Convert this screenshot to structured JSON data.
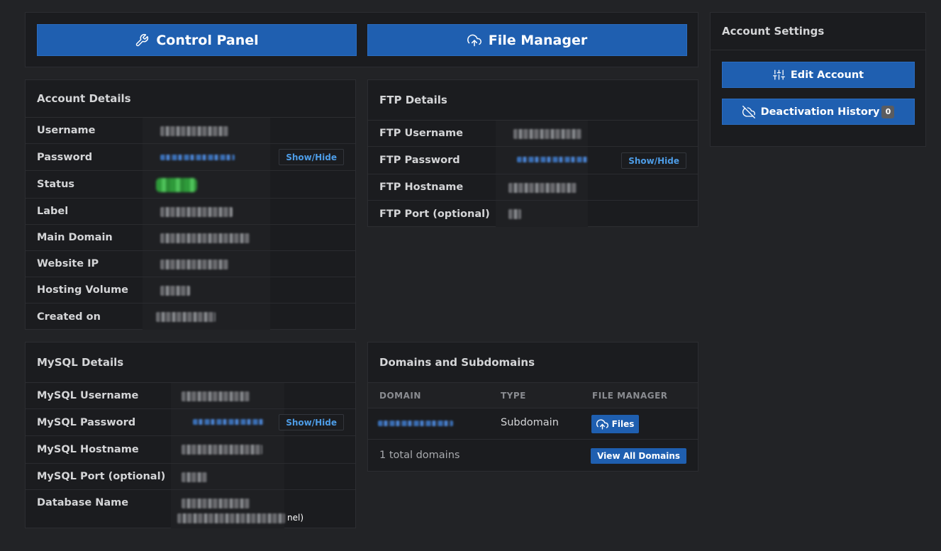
{
  "top_buttons": {
    "control_panel": "Control Panel",
    "file_manager": "File Manager"
  },
  "account_details": {
    "title": "Account Details",
    "rows": [
      {
        "label": "Username"
      },
      {
        "label": "Password"
      },
      {
        "label": "Status"
      },
      {
        "label": "Label"
      },
      {
        "label": "Main Domain"
      },
      {
        "label": "Website IP"
      },
      {
        "label": "Hosting Volume"
      },
      {
        "label": "Created on"
      }
    ],
    "show_hide": "Show/Hide"
  },
  "ftp_details": {
    "title": "FTP Details",
    "rows": [
      {
        "label": "FTP Username"
      },
      {
        "label": "FTP Password"
      },
      {
        "label": "FTP Hostname"
      },
      {
        "label": "FTP Port (optional)"
      }
    ],
    "show_hide": "Show/Hide"
  },
  "mysql_details": {
    "title": "MySQL Details",
    "rows": [
      {
        "label": "MySQL Username"
      },
      {
        "label": "MySQL Password"
      },
      {
        "label": "MySQL Hostname"
      },
      {
        "label": "MySQL Port (optional)"
      },
      {
        "label": "Database Name",
        "suffix": "nel)"
      }
    ],
    "show_hide": "Show/Hide"
  },
  "domains": {
    "title": "Domains and Subdomains",
    "headers": [
      "DOMAIN",
      "TYPE",
      "FILE MANAGER"
    ],
    "rows": [
      {
        "type": "Subdomain",
        "files_label": "Files"
      }
    ],
    "total": "1 total domains",
    "view_all": "View All Domains"
  },
  "account_settings": {
    "title": "Account Settings",
    "edit_account": "Edit Account",
    "deactivation_history": "Deactivation History",
    "deactivation_count": "0"
  },
  "colors": {
    "background": "#222326",
    "card": "#1b1c1f",
    "primary_button": "#1f5fb0",
    "link": "#4d9ce6"
  },
  "icons": {
    "control_panel": "wrench-icon",
    "file_manager": "cloud-upload-icon",
    "edit_account": "sliders-icon",
    "deactivation_history": "cloud-off-icon",
    "files": "cloud-upload-icon"
  }
}
